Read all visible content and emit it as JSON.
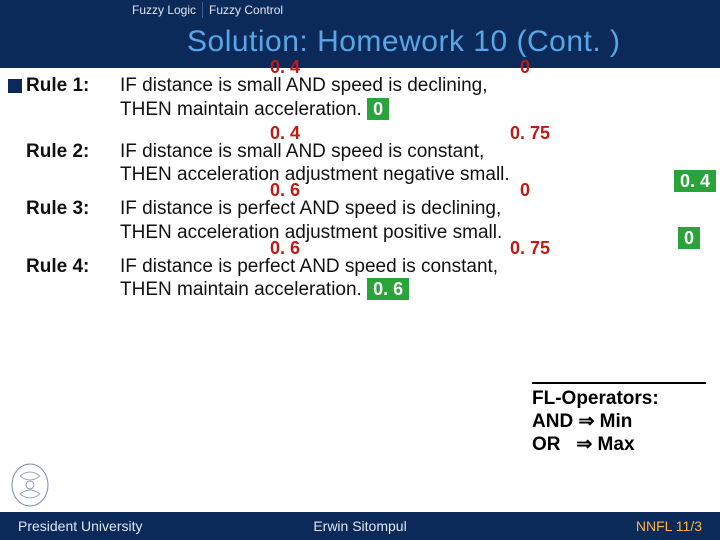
{
  "tabs": {
    "t1": "Fuzzy Logic",
    "t2": "Fuzzy Control"
  },
  "title": "Solution: Homework 10 (Cont. )",
  "rules": {
    "r1": {
      "label": "Rule 1",
      "line1_a": "IF distance is small AND speed is declining,",
      "line2_a": "THEN maintain acceleration.",
      "over1": "0. 4",
      "over2": "0",
      "boxA": "0"
    },
    "r2": {
      "label": "Rule 2",
      "line1_a": "IF distance is small AND speed is constant,",
      "line2_a": "THEN acceleration adjustment negative small.",
      "over1": "0. 4",
      "over2": "0. 75",
      "boxA": "0. 4"
    },
    "r3": {
      "label": "Rule 3",
      "line1_a": "IF distance is perfect AND speed is declining,",
      "line2_a": "THEN acceleration adjustment positive small.",
      "over1": "0. 6",
      "over2": "0",
      "boxA": "0"
    },
    "r4": {
      "label": "Rule 4",
      "line1_a": "IF distance is perfect AND speed is constant,",
      "line2_a": "THEN maintain acceleration.",
      "over1": "0. 6",
      "over2": "0. 75",
      "boxA": "0. 6"
    }
  },
  "flops": {
    "title": "FL-Operators:",
    "l1a": "AND",
    "l1b": "Min",
    "l2a": "OR",
    "l2b": "Max"
  },
  "footer": {
    "left": "President University",
    "mid": "Erwin Sitompul",
    "right": "NNFL 11/3"
  }
}
